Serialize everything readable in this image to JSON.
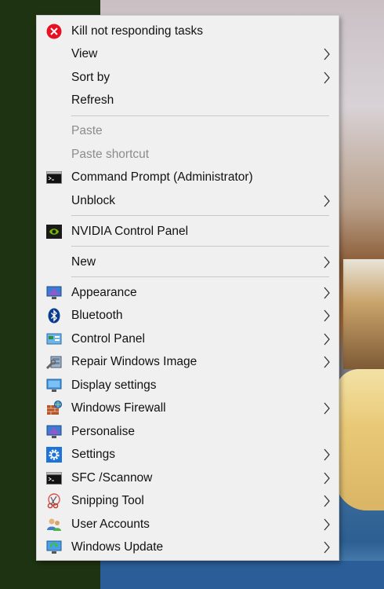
{
  "menu": {
    "items": [
      {
        "label": "Kill not responding tasks",
        "icon": "kill-tasks-icon",
        "submenu": false,
        "disabled": false
      },
      {
        "label": "View",
        "icon": "",
        "submenu": true,
        "disabled": false
      },
      {
        "label": "Sort by",
        "icon": "",
        "submenu": true,
        "disabled": false
      },
      {
        "label": "Refresh",
        "icon": "",
        "submenu": false,
        "disabled": false
      },
      {
        "label": "Paste",
        "icon": "",
        "submenu": false,
        "disabled": true
      },
      {
        "label": "Paste shortcut",
        "icon": "",
        "submenu": false,
        "disabled": true
      },
      {
        "label": "Command Prompt (Administrator)",
        "icon": "command-prompt-icon",
        "submenu": false,
        "disabled": false
      },
      {
        "label": "Unblock",
        "icon": "",
        "submenu": true,
        "disabled": false
      },
      {
        "label": "NVIDIA Control Panel",
        "icon": "nvidia-icon",
        "submenu": false,
        "disabled": false
      },
      {
        "label": "New",
        "icon": "",
        "submenu": true,
        "disabled": false
      },
      {
        "label": "Appearance",
        "icon": "appearance-icon",
        "submenu": true,
        "disabled": false
      },
      {
        "label": "Bluetooth",
        "icon": "bluetooth-icon",
        "submenu": true,
        "disabled": false
      },
      {
        "label": "Control Panel",
        "icon": "control-panel-icon",
        "submenu": true,
        "disabled": false
      },
      {
        "label": "Repair Windows Image",
        "icon": "repair-image-icon",
        "submenu": true,
        "disabled": false
      },
      {
        "label": "Display settings",
        "icon": "display-settings-icon",
        "submenu": false,
        "disabled": false
      },
      {
        "label": "Windows Firewall",
        "icon": "firewall-icon",
        "submenu": true,
        "disabled": false
      },
      {
        "label": "Personalise",
        "icon": "personalise-icon",
        "submenu": false,
        "disabled": false
      },
      {
        "label": "Settings",
        "icon": "settings-gear-icon",
        "submenu": true,
        "disabled": false
      },
      {
        "label": "SFC /Scannow",
        "icon": "sfc-terminal-icon",
        "submenu": true,
        "disabled": false
      },
      {
        "label": "Snipping Tool",
        "icon": "snipping-tool-icon",
        "submenu": true,
        "disabled": false
      },
      {
        "label": "User Accounts",
        "icon": "user-accounts-icon",
        "submenu": true,
        "disabled": false
      },
      {
        "label": "Windows Update",
        "icon": "windows-update-icon",
        "submenu": true,
        "disabled": false
      }
    ]
  },
  "colors": {
    "menu_bg": "#f0f0f0",
    "text": "#111111",
    "disabled_text": "#8c8c8c",
    "separator": "#c8c8c8",
    "kill_red": "#e81123",
    "nvidia_green": "#76b900"
  }
}
